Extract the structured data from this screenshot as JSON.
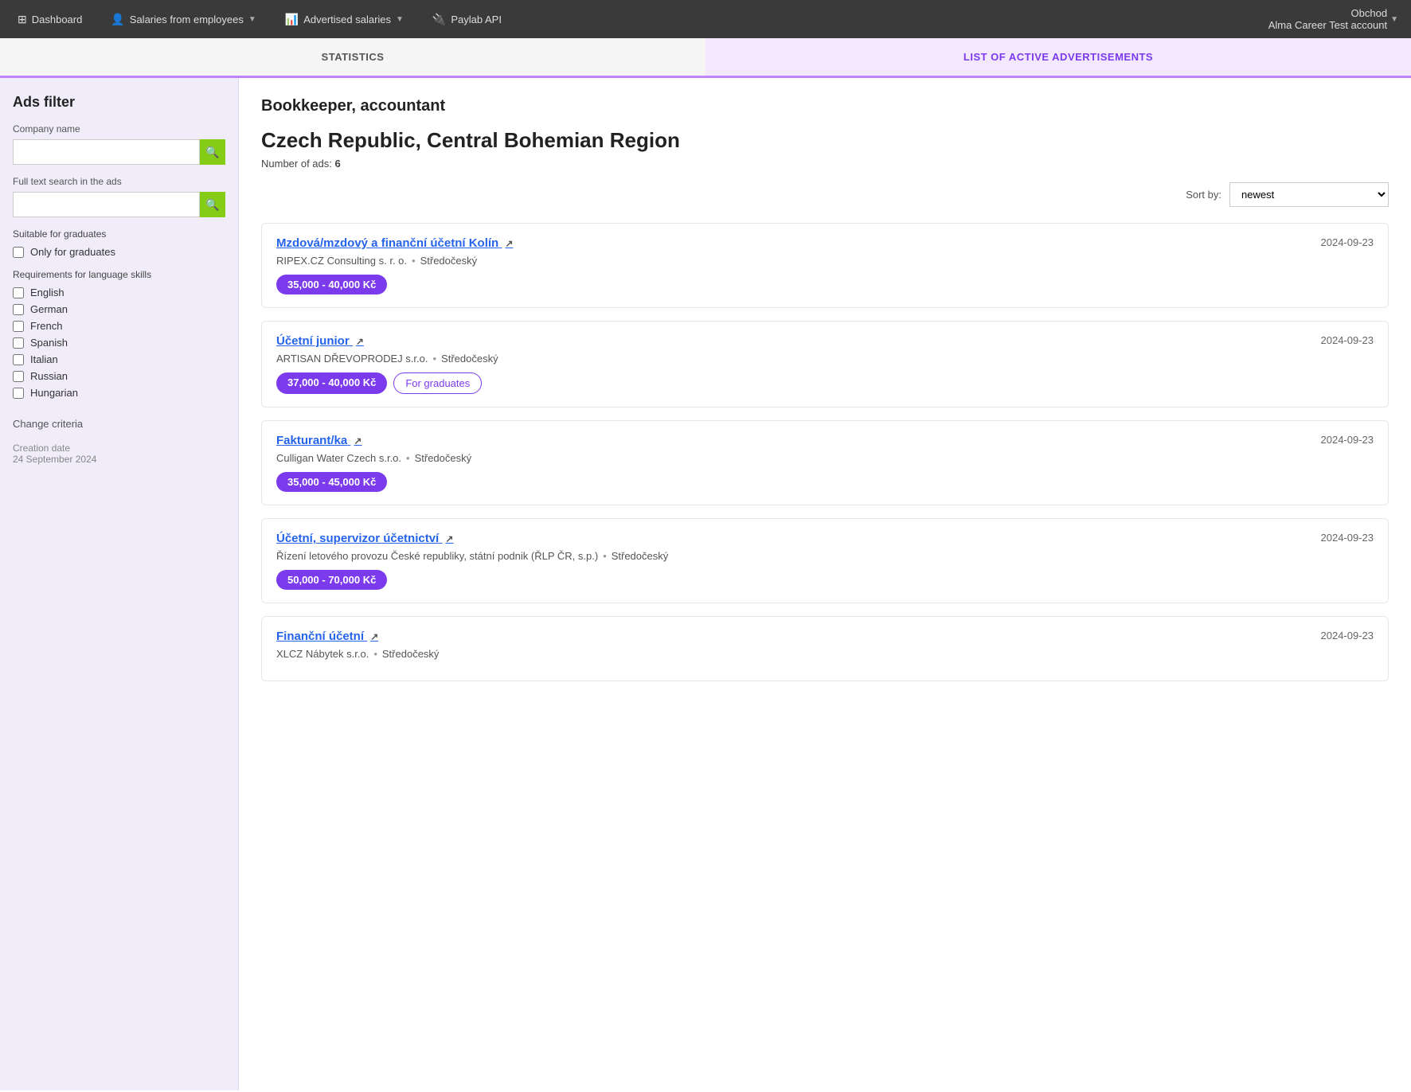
{
  "topnav": {
    "dashboard_label": "Dashboard",
    "salaries_employees_label": "Salaries from employees",
    "advertised_salaries_label": "Advertised salaries",
    "paylab_api_label": "Paylab API",
    "account_name": "Obchod",
    "account_sub": "Alma Career Test account"
  },
  "tabs": [
    {
      "id": "statistics",
      "label": "STATISTICS",
      "active": false
    },
    {
      "id": "active-ads",
      "label": "LIST OF ACTIVE ADVERTISEMENTS",
      "active": true
    }
  ],
  "sidebar": {
    "title": "Ads filter",
    "company_name_label": "Company name",
    "company_name_placeholder": "",
    "fulltext_label": "Full text search in the ads",
    "fulltext_placeholder": "",
    "graduates_section_label": "Suitable for graduates",
    "only_graduates_label": "Only for graduates",
    "languages_label": "Requirements for language skills",
    "languages": [
      {
        "label": "English",
        "checked": false
      },
      {
        "label": "German",
        "checked": false
      },
      {
        "label": "French",
        "checked": false
      },
      {
        "label": "Spanish",
        "checked": false
      },
      {
        "label": "Italian",
        "checked": false
      },
      {
        "label": "Russian",
        "checked": false
      },
      {
        "label": "Hungarian",
        "checked": false
      }
    ],
    "change_criteria_label": "Change criteria",
    "creation_date_label": "Creation date",
    "creation_date_value": "24 September 2024"
  },
  "content": {
    "title": "Bookkeeper, accountant",
    "region": "Czech Republic, Central Bohemian Region",
    "ads_count_label": "Number of ads:",
    "ads_count": "6",
    "sort_label": "Sort by:",
    "sort_option": "newest",
    "jobs": [
      {
        "title": "Mzdová/mzdový a finanční účetní Kolín",
        "date": "2024-09-23",
        "company": "RIPEX.CZ Consulting s. r. o.",
        "region": "Středočeský",
        "salary": "35,000 - 40,000 Kč",
        "for_graduates": false
      },
      {
        "title": "Účetní junior",
        "date": "2024-09-23",
        "company": "ARTISAN DŘEVOPRODEJ s.r.o.",
        "region": "Středočeský",
        "salary": "37,000 - 40,000 Kč",
        "for_graduates": true
      },
      {
        "title": "Fakturant/ka",
        "date": "2024-09-23",
        "company": "Culligan Water Czech s.r.o.",
        "region": "Středočeský",
        "salary": "35,000 - 45,000 Kč",
        "for_graduates": false
      },
      {
        "title": "Účetní, supervizor účetnictví",
        "date": "2024-09-23",
        "company": "Řízení letového provozu České republiky, státní podnik (ŘLP ČR, s.p.)",
        "region": "Středočeský",
        "salary": "50,000 - 70,000 Kč",
        "for_graduates": false
      },
      {
        "title": "Finanční účetní",
        "date": "2024-09-23",
        "company": "XLCZ Nábytek s.r.o.",
        "region": "Středočeský",
        "salary": "",
        "for_graduates": false
      }
    ],
    "for_graduates_tag": "For graduates"
  }
}
